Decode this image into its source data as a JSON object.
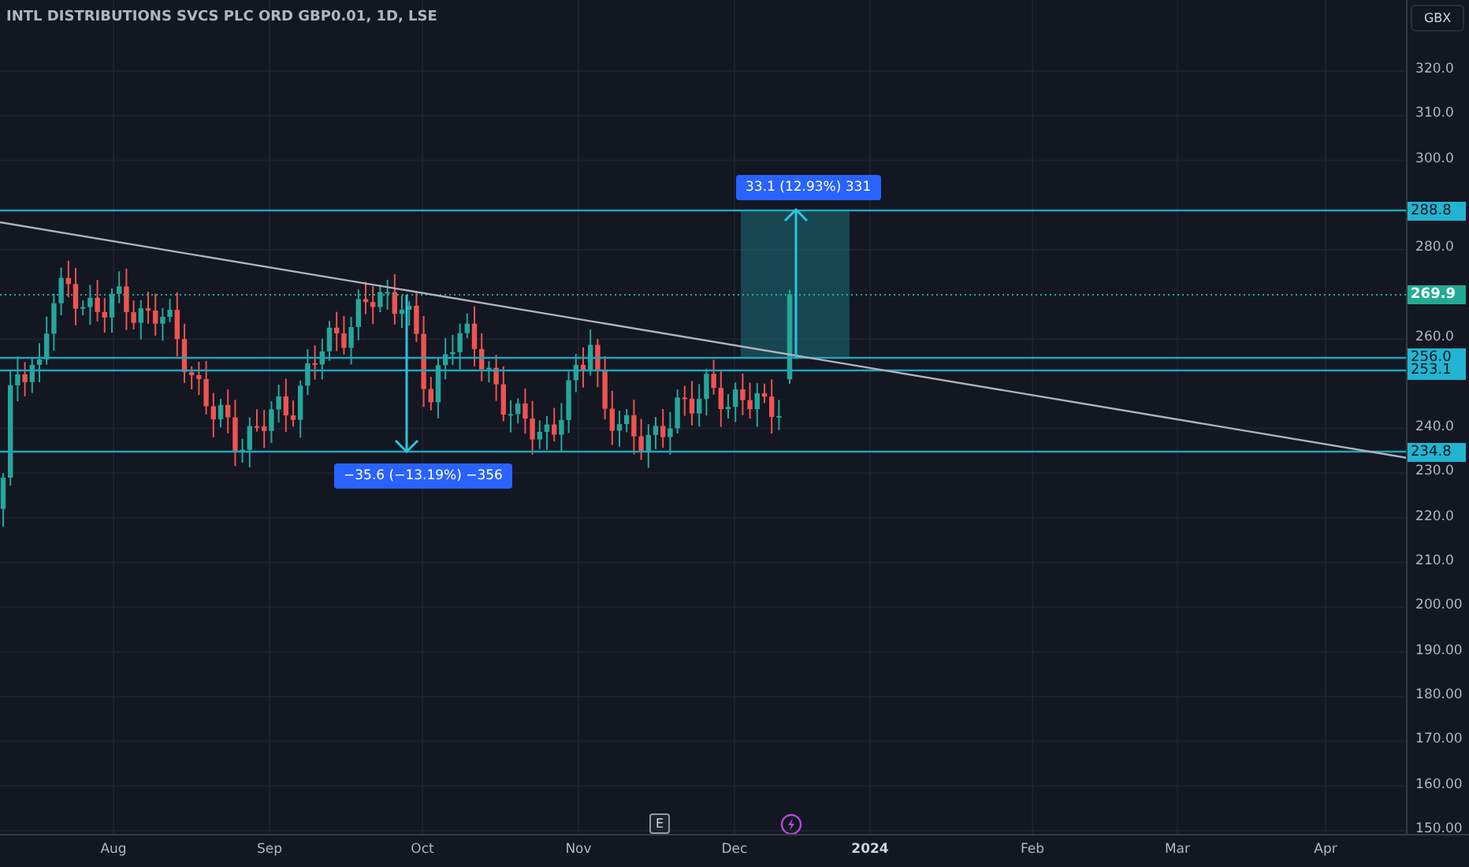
{
  "chart": {
    "title": "INTL DISTRIBUTIONS SVCS PLC ORD GBP0.01, 1D, LSE",
    "currency_button": "GBX",
    "measurements": [
      {
        "kind": "up",
        "label": "33.1 (12.93%) 331"
      },
      {
        "kind": "down",
        "label": "−35.6 (−13.19%) −356"
      }
    ],
    "price_axis": {
      "ticks": [
        "320.0",
        "310.0",
        "300.0",
        "280.0",
        "260.0",
        "240.0",
        "230.0",
        "220.0",
        "210.0",
        "200.00",
        "190.00",
        "180.00",
        "170.00",
        "160.00",
        "150.00"
      ],
      "price_labels": [
        {
          "text": "288.8",
          "color": "#22b4d0"
        },
        {
          "text": "269.9",
          "color": "#22ab94"
        },
        {
          "text": "256.0",
          "color": "#22b4d0"
        },
        {
          "text": "253.1",
          "color": "#22b4d0"
        },
        {
          "text": "234.8",
          "color": "#22b4d0"
        }
      ]
    },
    "event_markers": [
      {
        "kind": "earnings",
        "label": "E"
      },
      {
        "kind": "dividend"
      }
    ],
    "time_axis": [
      {
        "label": "Aug",
        "kind": "month"
      },
      {
        "label": "Sep",
        "kind": "month"
      },
      {
        "label": "Oct",
        "kind": "month"
      },
      {
        "label": "Nov",
        "kind": "month"
      },
      {
        "label": "Dec",
        "kind": "month"
      },
      {
        "label": "2024",
        "kind": "year"
      },
      {
        "label": "Feb",
        "kind": "month"
      },
      {
        "label": "Mar",
        "kind": "month"
      },
      {
        "label": "Apr",
        "kind": "month"
      }
    ]
  }
}
